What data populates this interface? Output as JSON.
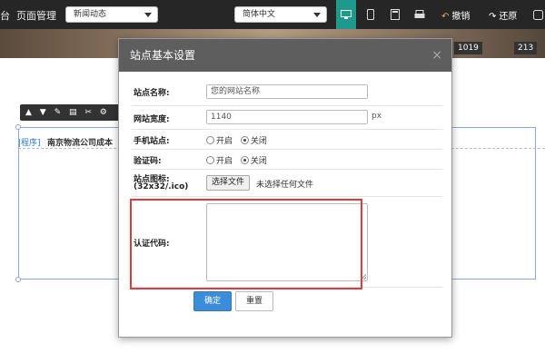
{
  "toolbar": {
    "cut_text": "台",
    "page_manage": "页面管理",
    "page_select": "新闻动态",
    "lang_select": "简体中文",
    "undo": "撤销",
    "redo": "还原"
  },
  "banner": {
    "num1": "1019",
    "num2": "213"
  },
  "background": {
    "link": "|程序]",
    "text": "南京物流公司成本"
  },
  "modal": {
    "title": "站点基本设置",
    "close": "×",
    "site_name_label": "站点名称:",
    "site_name_value": "您的网站名称",
    "width_label": "网站宽度:",
    "width_value": "1140",
    "width_unit": "px",
    "mobile_label": "手机站点:",
    "captcha_label": "验证码:",
    "opt_on": "开启",
    "opt_off": "关闭",
    "icon_label_1": "站点图标:",
    "icon_label_2": "(32x32/.ico)",
    "choose_file": "选择文件",
    "no_file": "未选择任何文件",
    "auth_label": "认证代码:",
    "ok": "确定",
    "reset": "重置"
  }
}
